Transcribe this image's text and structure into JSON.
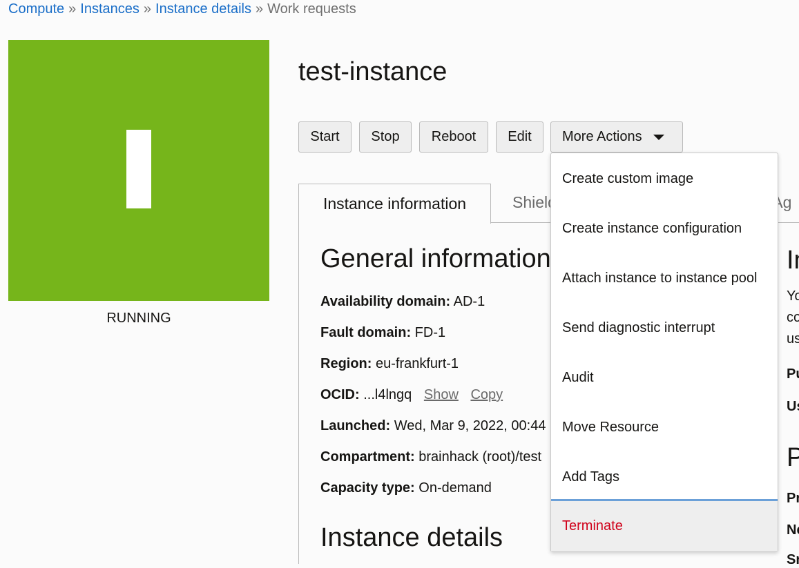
{
  "breadcrumb": {
    "items": [
      "Compute",
      "Instances",
      "Instance details"
    ],
    "current": "Work requests",
    "separator": "»"
  },
  "status": {
    "label": "RUNNING",
    "tile_color": "#76b51b",
    "glyph": "I"
  },
  "title": "test-instance",
  "actions": {
    "start": "Start",
    "stop": "Stop",
    "reboot": "Reboot",
    "edit": "Edit",
    "more": "More Actions"
  },
  "tabs": {
    "active": "Instance information",
    "shield": "Shield",
    "agent": "l Ag"
  },
  "general": {
    "heading": "General information",
    "availability_domain_label": "Availability domain:",
    "availability_domain_value": "AD-1",
    "fault_domain_label": "Fault domain:",
    "fault_domain_value": "FD-1",
    "region_label": "Region:",
    "region_value": "eu-frankfurt-1",
    "ocid_label": "OCID:",
    "ocid_value": "...l4lngq",
    "ocid_show": "Show",
    "ocid_copy": "Copy",
    "launched_label": "Launched:",
    "launched_value": "Wed, Mar 9, 2022, 00:44",
    "compartment_label": "Compartment:",
    "compartment_value": "brainhack (root)/test",
    "capacity_label": "Capacity type:",
    "capacity_value": "On-demand"
  },
  "details": {
    "heading": "Instance details"
  },
  "right_column": {
    "heading1": "In",
    "line1": "Yo",
    "line2": "co",
    "line3": "us",
    "bold1": "Pu",
    "bold2": "Us",
    "heading2": "P",
    "bold3": "Pr",
    "bold4": "Ne",
    "bold5": "Sr"
  },
  "menu": {
    "items": [
      "Create custom image",
      "Create instance configuration",
      "Attach instance to instance pool",
      "Send diagnostic interrupt",
      "Audit",
      "Move Resource",
      "Add Tags",
      "Terminate"
    ],
    "danger_color": "#d0021b"
  }
}
